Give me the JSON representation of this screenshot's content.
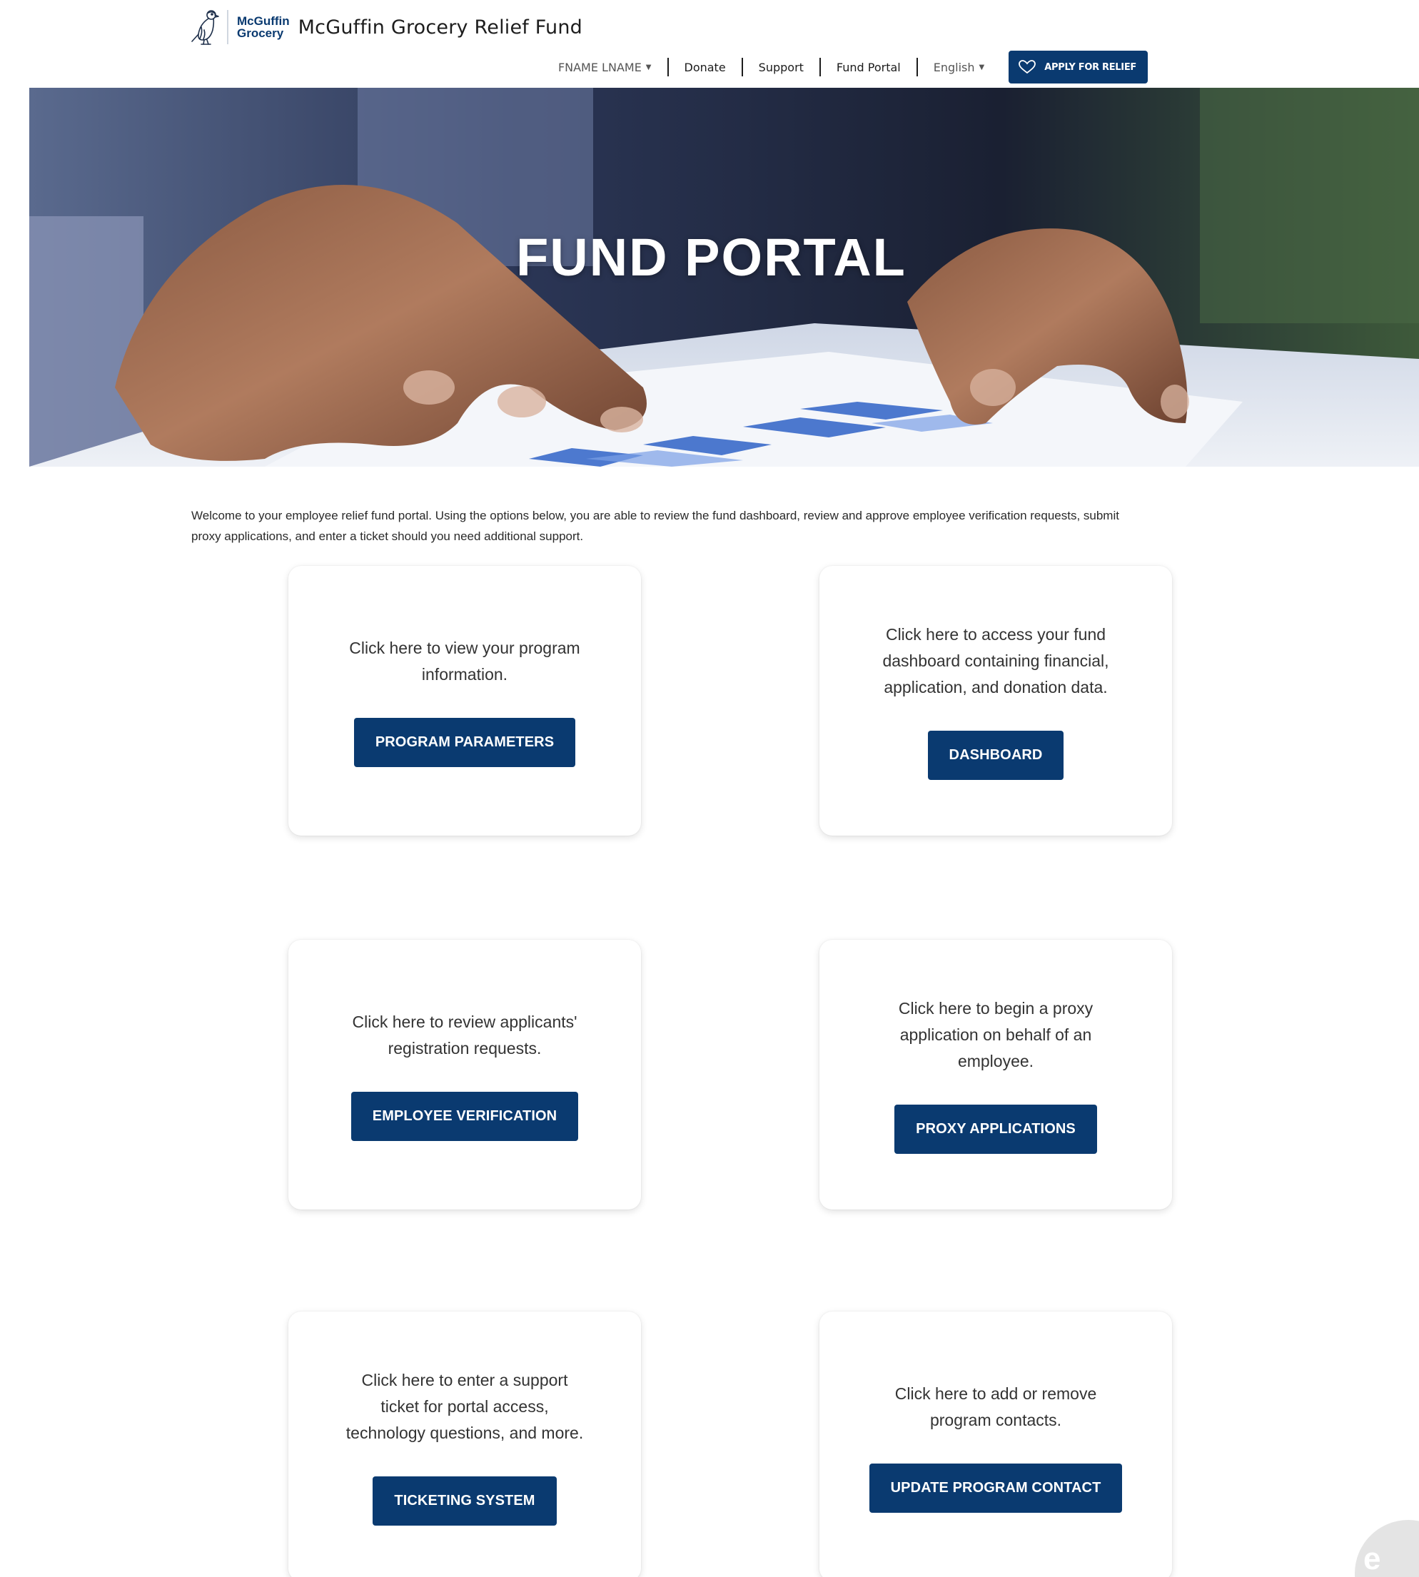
{
  "header": {
    "logo_line1": "McGuffin",
    "logo_line2": "Grocery",
    "site_title": "McGuffin Grocery Relief Fund"
  },
  "nav": {
    "user": "FNAME LNAME",
    "donate": "Donate",
    "support": "Support",
    "fund_portal": "Fund Portal",
    "language": "English",
    "apply_button": "APPLY FOR RELIEF"
  },
  "hero": {
    "title": "FUND PORTAL"
  },
  "intro": {
    "text": "Welcome to your employee relief fund portal. Using the options below, you are able to review the fund dashboard, review and approve employee verification requests, submit proxy applications, and enter a ticket should you need additional support."
  },
  "cards": [
    {
      "text": "Click here to view your program information.",
      "button": "PROGRAM PARAMETERS"
    },
    {
      "text": "Click here to access your fund dashboard containing financial, application, and donation data.",
      "button": "DASHBOARD"
    },
    {
      "text": "Click here to review applicants' registration requests.",
      "button": "EMPLOYEE VERIFICATION"
    },
    {
      "text": "Click here to begin a proxy application on behalf of an employee.",
      "button": "PROXY APPLICATIONS"
    },
    {
      "text": "Click here to enter a support ticket for portal access, technology questions, and more.",
      "button": "TICKETING SYSTEM"
    },
    {
      "text": "Click here to add or remove program contacts.",
      "button": "UPDATE PROGRAM CONTACT"
    }
  ],
  "corner_badge": {
    "letter": "e"
  },
  "colors": {
    "brand_navy": "#0a3a70",
    "page_background": "#ffffff"
  },
  "icons": {
    "logo": "bird-logo-icon",
    "apply": "heart-icon",
    "dropdown": "caret-down-icon"
  }
}
